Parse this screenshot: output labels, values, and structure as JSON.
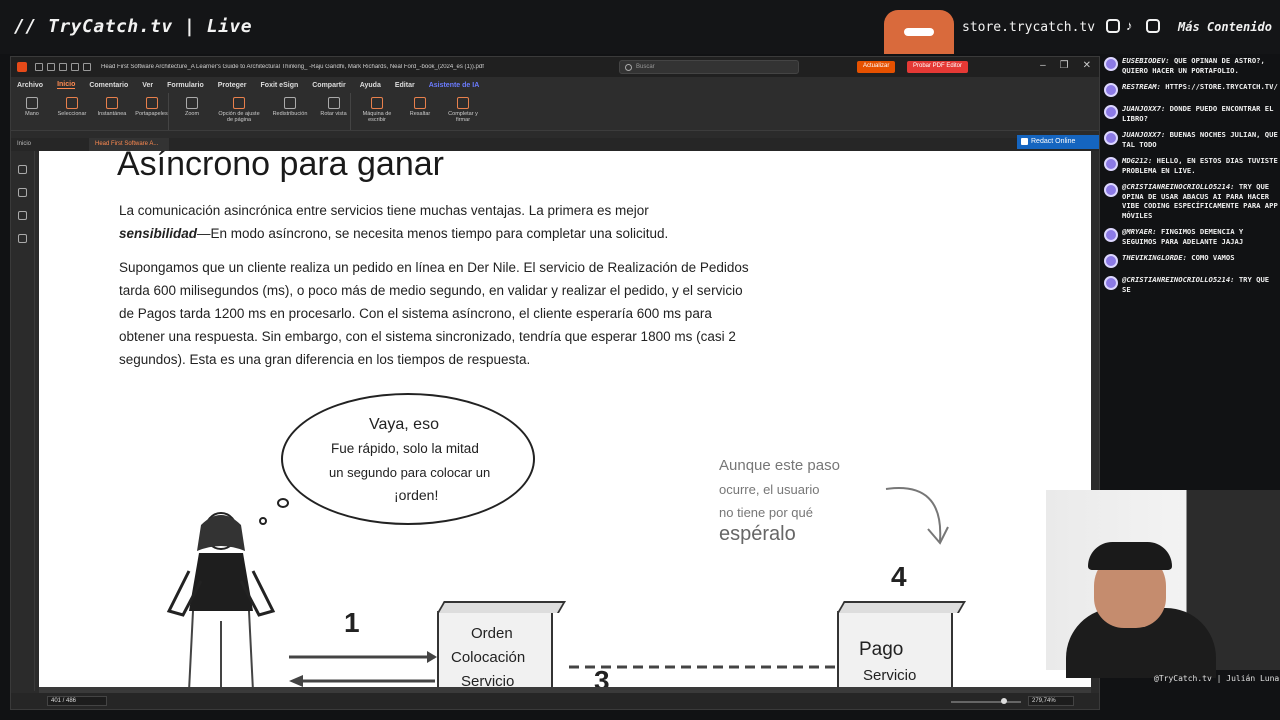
{
  "stream": {
    "brand": "// TryCatch.tv | Live",
    "store_url": "store.trycatch.tv",
    "more_content": "Más Contenido",
    "social_icons": [
      "instagram-icon",
      "tiktok-icon",
      "youtube-icon"
    ]
  },
  "app": {
    "doc_title": "Head First Software Architecture_A Learner's Guide to Architectural Thinking_ -Raju Gandhi, Mark Richards, Neal Ford_-book_(2024_es (1)).pdf",
    "search_placeholder": "Buscar",
    "update_label": "Actualizar",
    "try_label": "Probar PDF Editor",
    "menu": [
      "Archivo",
      "Inicio",
      "Comentario",
      "Ver",
      "Formulario",
      "Proteger",
      "Foxit eSign",
      "Compartir",
      "Ayuda",
      "Editar",
      "Asistente de IA"
    ],
    "menu_active": "Inicio",
    "ribbon": [
      {
        "label": "Mano"
      },
      {
        "label": "Seleccionar"
      },
      {
        "label": "Instantánea"
      },
      {
        "label": "Portapapeles"
      },
      {
        "label": "Zoom"
      },
      {
        "label": "Opción de ajuste de página"
      },
      {
        "label": "Redistribución"
      },
      {
        "label": "Rotar vista"
      },
      {
        "label": "Máquina de escribir"
      },
      {
        "label": "Resaltar"
      },
      {
        "label": "Completar y firmar"
      }
    ],
    "tabs": [
      "Inicio",
      "Head First Software A..."
    ],
    "redact_label": "Redact Online",
    "status": {
      "page": "401 / 486",
      "zoom": "279,74%"
    }
  },
  "document": {
    "heading": "Asíncrono para ganar",
    "para1_pre": "La comunicación asincrónica entre servicios tiene muchas ventajas. La primera es mejor",
    "para1_bold": "sensibilidad",
    "para1_post": "—En modo asíncrono, se necesita menos tiempo para completar una solicitud.",
    "para2": "Supongamos que un cliente realiza un pedido en línea en Der Nile. El servicio de Realización de Pedidos tarda 600 milisegundos (ms), o poco más de medio segundo, en validar y realizar el pedido, y el servicio de Pagos tarda 1200 ms en procesarlo. Con el sistema asíncrono, el cliente esperaría 600 ms para obtener una respuesta. Sin embargo, con el sistema sincronizado, tendría que esperar 1800 ms (casi 2 segundos). Esta es una gran diferencia en los tiempos de respuesta.",
    "bubble": {
      "line1": "Vaya, eso",
      "line2": "Fue rápido, solo la mitad",
      "line3": "un segundo para colocar un",
      "line4": "¡orden!"
    },
    "note": {
      "line1": "Aunque este paso",
      "line2": "ocurre, el usuario",
      "line3": "no tiene por qué",
      "line4": "espéralo"
    },
    "step_numbers": [
      "1",
      "3",
      "4"
    ],
    "box1": [
      "Orden",
      "Colocación",
      "Servicio"
    ],
    "box2": [
      "Pago",
      "Servicio"
    ]
  },
  "chat": [
    {
      "user": "EUSEBIODEV:",
      "text": "QUE OPINAN DE ASTRO?, QUIERO HACER UN PORTAFOLIO."
    },
    {
      "user": "RESTREAM:",
      "text": "HTTPS://STORE.TRYCATCH.TV/"
    },
    {
      "user": "JUANJOXX7:",
      "text": "DONDE PUEDO ENCONTRAR EL LIBRO?"
    },
    {
      "user": "JUANJOXX7:",
      "text": "BUENAS NOCHES JULIAN, QUE TAL TODO"
    },
    {
      "user": "MDG212:",
      "text": "HELLO, EN ESTOS DIAS TUVISTE PROBLEMA EN LIVE."
    },
    {
      "user": "@CRISTIANREINOCRIOLLO5214:",
      "text": "TRY QUE OPINA DE USAR ABACUS AI PARA HACER VIBE CODING ESPECÍFICAMENTE PARA APP MÓVILES"
    },
    {
      "user": "@MRYAER:",
      "text": "FINGIMOS DEMENCIA Y SEGUIMOS PARA ADELANTE JAJAJ"
    },
    {
      "user": "THEVIKINGLORDE:",
      "text": "COMO VAMOS"
    },
    {
      "user": "@CRISTIANREINOCRIOLLO5214:",
      "text": "TRY QUE SE"
    }
  ],
  "camera_label": "@TryCatch.tv | Julián Luna"
}
